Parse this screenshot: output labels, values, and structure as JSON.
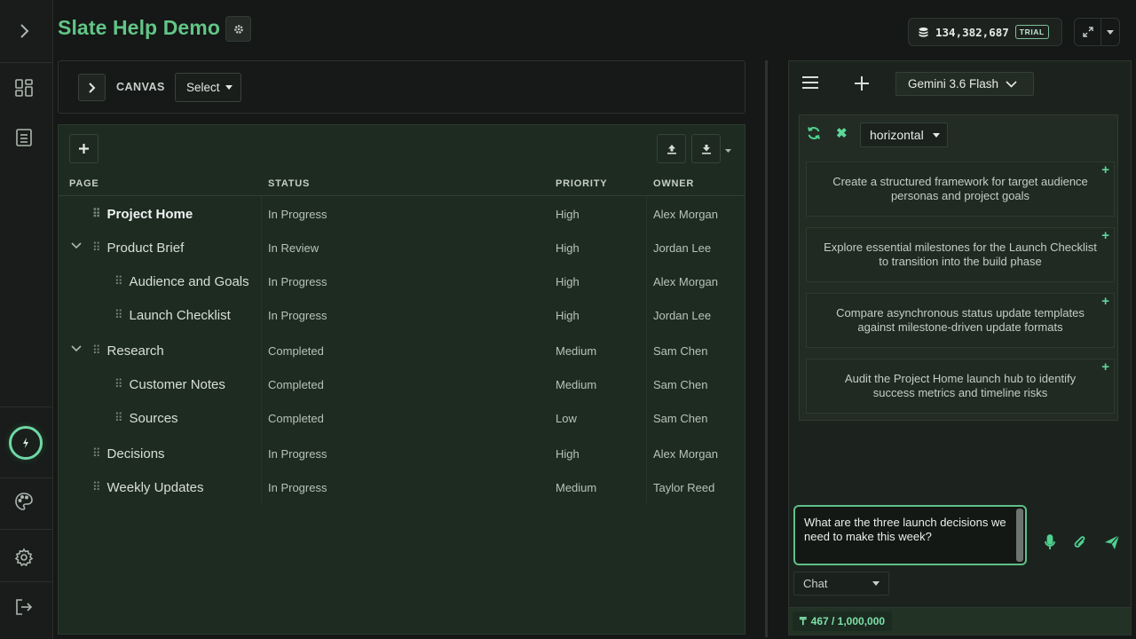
{
  "app": {
    "title": "Slate Help Demo",
    "credits": "134,382,687",
    "plan_badge": "TRIAL"
  },
  "sidebar": {
    "icons": [
      "expand-sidebar-icon",
      "dashboard-icon",
      "document-icon",
      "power-icon",
      "palette-icon",
      "gear-icon",
      "logout-icon"
    ]
  },
  "canvas": {
    "label": "CANVAS",
    "select_label": "Select"
  },
  "table": {
    "columns": [
      "PAGE",
      "STATUS",
      "PRIORITY",
      "OWNER"
    ],
    "rows": [
      {
        "page": "Project Home",
        "status": "In Progress",
        "priority": "High",
        "owner": "Alex Morgan"
      },
      {
        "page": "Product Brief",
        "status": "In Review",
        "priority": "High",
        "owner": "Jordan Lee"
      },
      {
        "page": "Audience and Goals",
        "status": "In Progress",
        "priority": "High",
        "owner": "Alex Morgan"
      },
      {
        "page": "Launch Checklist",
        "status": "In Progress",
        "priority": "High",
        "owner": "Jordan Lee"
      },
      {
        "page": "Research",
        "status": "Completed",
        "priority": "Medium",
        "owner": "Sam Chen"
      },
      {
        "page": "Customer Notes",
        "status": "Completed",
        "priority": "Medium",
        "owner": "Sam Chen"
      },
      {
        "page": "Sources",
        "status": "Completed",
        "priority": "Low",
        "owner": "Sam Chen"
      },
      {
        "page": "Decisions",
        "status": "In Progress",
        "priority": "High",
        "owner": "Alex Morgan"
      },
      {
        "page": "Weekly Updates",
        "status": "In Progress",
        "priority": "Medium",
        "owner": "Taylor Reed"
      }
    ]
  },
  "chat": {
    "model": "Gemini 3.6 Flash",
    "layout_mode": "horizontal",
    "suggestions": [
      "Create a  structured framework  for target audience personas and  project goals",
      "Explore essential milestones for the  Launch Checklist  to transition into the  build phase",
      "Compare  asynchronous status update  templates against  milestone-driven update  formats",
      "Audit the  Project Home  launch hub to identify success metrics  and timeline risks"
    ],
    "input_value": "What are the three launch decisions we need to make this week?",
    "mode": "Chat",
    "tokens": "467 / 1,000,000"
  },
  "colors": {
    "accent": "#62c586",
    "bright_accent": "#4fd190",
    "panel": "#1d2b21",
    "background": "#151816"
  }
}
